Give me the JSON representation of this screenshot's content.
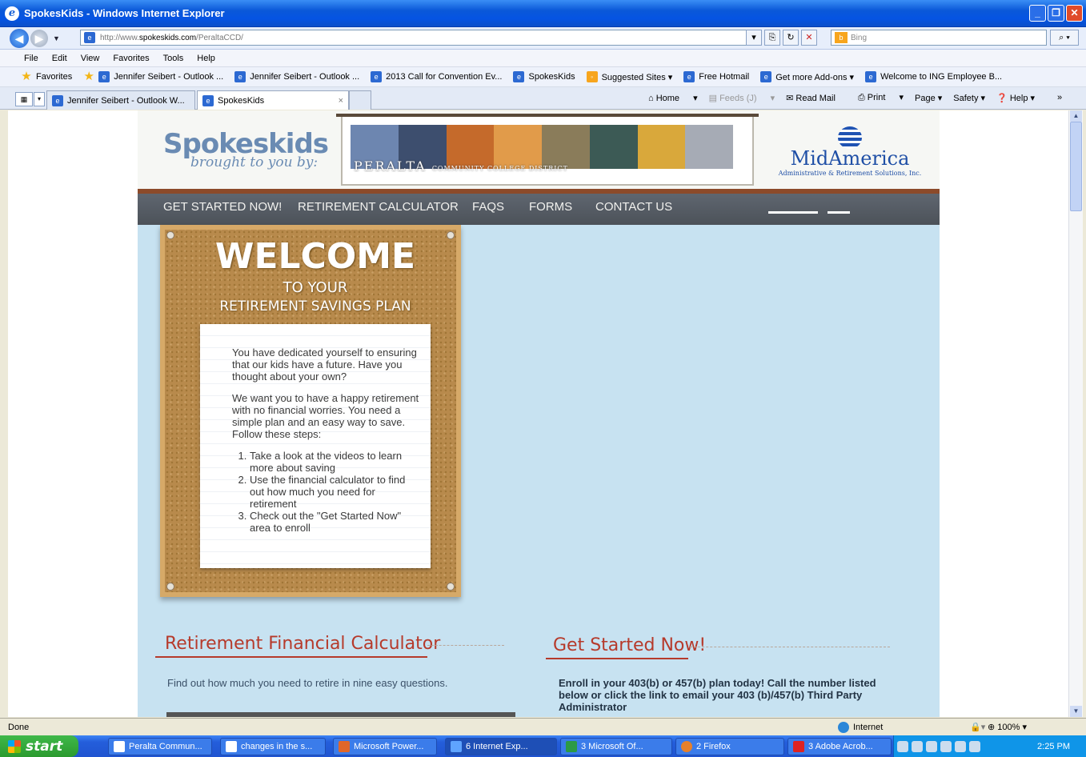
{
  "window": {
    "title": "SpokesKids - Windows Internet Explorer"
  },
  "address": {
    "prefix": "http://www.",
    "domain": "spokeskids.com",
    "path": "/PeraltaCCD/",
    "search_placeholder": "Bing"
  },
  "menu": [
    "File",
    "Edit",
    "View",
    "Favorites",
    "Tools",
    "Help"
  ],
  "favorites": {
    "label": "Favorites",
    "items": [
      "Jennifer Seibert - Outlook ...",
      "Jennifer Seibert - Outlook ...",
      "2013 Call for Convention Ev...",
      "SpokesKids",
      "Suggested Sites ▾",
      "Free Hotmail",
      "Get more Add-ons ▾",
      "Welcome to ING Employee B..."
    ]
  },
  "tabs": [
    {
      "label": "Jennifer Seibert - Outlook W...",
      "active": false
    },
    {
      "label": "SpokesKids",
      "active": true,
      "close": "×"
    }
  ],
  "tab_tools": {
    "home": "Home",
    "feeds": "Feeds (J)",
    "read_mail": "Read Mail",
    "print": "Print",
    "page": "Page ▾",
    "safety": "Safety ▾",
    "help": "Help ▾",
    "more": "»"
  },
  "site": {
    "logo_main": "Spokeskids",
    "logo_sub": "brought to you by:",
    "banner_text": "PERALTA",
    "banner_small": "COMMUNITY COLLEGE DISTRICT",
    "partner_name": "MidAmerica",
    "partner_sub": "Administrative & Retirement Solutions, Inc.",
    "nav": [
      "GET STARTED NOW!",
      "RETIREMENT CALCULATOR",
      "FAQS",
      "FORMS",
      "CONTACT US"
    ],
    "welcome": {
      "title": "WELCOME",
      "line2": "TO YOUR",
      "line3": "RETIREMENT SAVINGS PLAN"
    },
    "note": {
      "p1": "You have dedicated yourself to ensuring that our kids have a future. Have you thought about your own?",
      "p2": "We want you to have a happy retirement with no financial worries. You need a simple plan and an easy way to save. Follow these steps:",
      "steps": [
        "Take a look at the videos to learn more about saving",
        "Use the financial calculator to find out how much you need for retirement",
        "Check out the \"Get Started Now\" area to enroll"
      ]
    },
    "calc": {
      "heading": "Retirement Financial Calculator",
      "text": "Find out how much you need to retire in nine easy questions."
    },
    "started": {
      "heading": "Get Started Now!",
      "text": "Enroll in your 403(b) or 457(b) plan today! Call the number listed below or click the link to email your 403 (b)/457(b) Third Party Administrator"
    }
  },
  "status": {
    "left": "Done",
    "zone": "Internet",
    "zoom": "100%"
  },
  "taskbar": {
    "start": "start",
    "buttons": [
      "Peralta Commun...",
      "changes in the s...",
      "Microsoft Power...",
      "6 Internet Exp...",
      "3 Microsoft Of...",
      "2 Firefox",
      "3 Adobe Acrob..."
    ],
    "clock": "2:25 PM"
  }
}
